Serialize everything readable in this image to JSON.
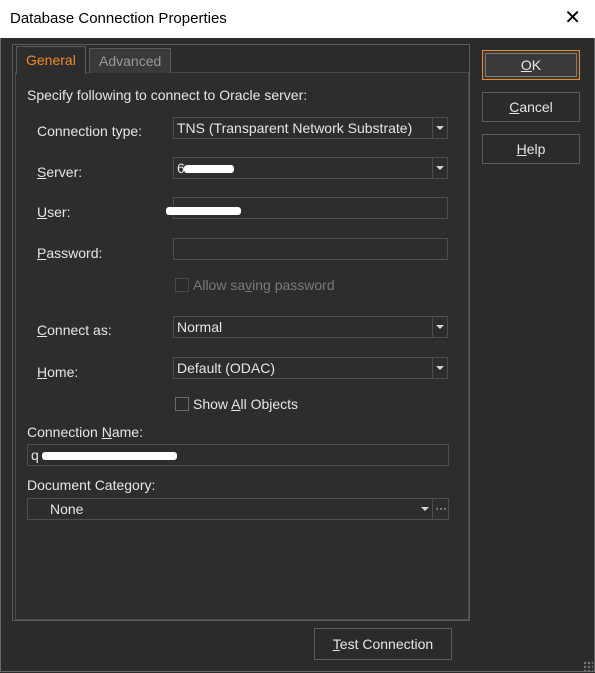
{
  "window": {
    "title": "Database Connection Properties"
  },
  "tabs": [
    {
      "label": "General"
    },
    {
      "label": "Advanced"
    }
  ],
  "general": {
    "intro": "Specify following to connect to Oracle server:",
    "connection_type": {
      "label": "Connection type:",
      "value": "TNS (Transparent Network Substrate)"
    },
    "server": {
      "label_u": "S",
      "label_rest": "erver:",
      "value": "6"
    },
    "user": {
      "label_u": "U",
      "label_rest": "ser:",
      "value": ""
    },
    "password": {
      "label_u": "P",
      "label_rest": "assword:",
      "value": ""
    },
    "allow_saving": {
      "label_pre": "Allow sa",
      "label_u": "v",
      "label_rest": "ing password",
      "checked": false,
      "enabled": false
    },
    "connect_as": {
      "label_pre": "",
      "label_u": "C",
      "label_rest": "onnect as:",
      "value": "Normal"
    },
    "home": {
      "label_u": "H",
      "label_rest": "ome:",
      "value": "Default (ODAC)"
    },
    "show_all": {
      "label_pre": "Show ",
      "label_u": "A",
      "label_rest": "ll Objects",
      "checked": false
    },
    "connection_name": {
      "label_pre": "Connection ",
      "label_u": "N",
      "label_rest": "ame:",
      "value": "q"
    },
    "document_category": {
      "label": "Document Category:",
      "value": "None"
    }
  },
  "buttons": {
    "ok": {
      "u": "O",
      "rest": "K"
    },
    "cancel": {
      "u": "C",
      "rest": "ancel"
    },
    "help": {
      "u": "H",
      "rest": "elp"
    },
    "test": {
      "u": "T",
      "rest": "est Connection"
    }
  },
  "colors": {
    "accent": "#f08a24",
    "background": "#2b2b2b",
    "text": "#e6e6e6"
  }
}
